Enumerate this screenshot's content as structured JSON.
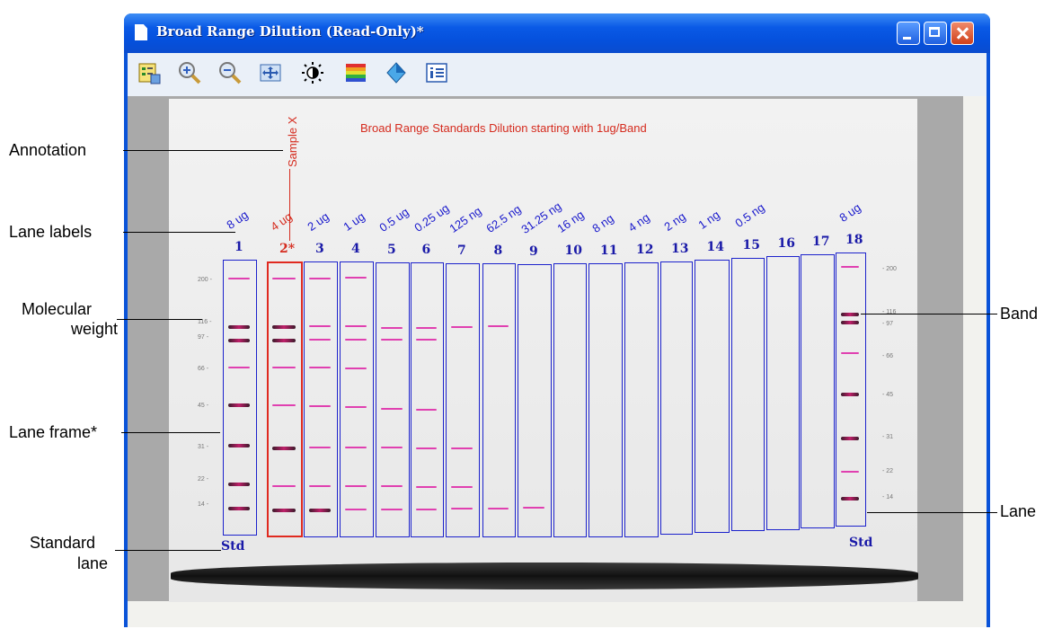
{
  "window": {
    "title": "Broad Range Dilution (Read-Only)*"
  },
  "toolbar": {
    "tools": [
      "lane-setup-icon",
      "zoom-in-icon",
      "zoom-out-icon",
      "fit-to-window-icon",
      "brightness-contrast-icon",
      "color-palette-icon",
      "transform-icon",
      "info-icon"
    ]
  },
  "gel": {
    "title": "Broad Range Standards Dilution starting with 1ug/Band",
    "annotation": "Sample X",
    "lanes": [
      {
        "number": "1",
        "label": "8 ug"
      },
      {
        "number": "2*",
        "label": "4 ug"
      },
      {
        "number": "3",
        "label": "2 ug"
      },
      {
        "number": "4",
        "label": "1 ug"
      },
      {
        "number": "5",
        "label": "0.5 ug"
      },
      {
        "number": "6",
        "label": "0.25 ug"
      },
      {
        "number": "7",
        "label": "125 ng"
      },
      {
        "number": "8",
        "label": "62.5 ng"
      },
      {
        "number": "9",
        "label": "31.25 ng"
      },
      {
        "number": "10",
        "label": "16 ng"
      },
      {
        "number": "11",
        "label": "8 ng"
      },
      {
        "number": "12",
        "label": "4 ng"
      },
      {
        "number": "13",
        "label": "2 ng"
      },
      {
        "number": "14",
        "label": "1 ng"
      },
      {
        "number": "15",
        "label": "0.5 ng"
      },
      {
        "number": "16",
        "label": ""
      },
      {
        "number": "17",
        "label": ""
      },
      {
        "number": "18",
        "label": "8 ug"
      }
    ],
    "mw_left": [
      "200",
      "116",
      "97",
      "66",
      "45",
      "31",
      "22",
      "14"
    ],
    "mw_right": [
      "200",
      "116",
      "97",
      "66",
      "45",
      "31",
      "22",
      "14"
    ],
    "std_left": "Std",
    "std_right": "Std",
    "colors": {
      "lane_frame": "#1c22cc",
      "selected": "#d52b1e",
      "band": "#e040b0"
    }
  },
  "callouts": {
    "annotation": "Annotation",
    "lane_labels": "Lane labels",
    "molecular_weight_1": "Molecular",
    "molecular_weight_2": "weight",
    "lane_frame": "Lane frame*",
    "standard_lane_1": "Standard",
    "standard_lane_2": "lane",
    "band": "Band",
    "lane": "Lane"
  }
}
